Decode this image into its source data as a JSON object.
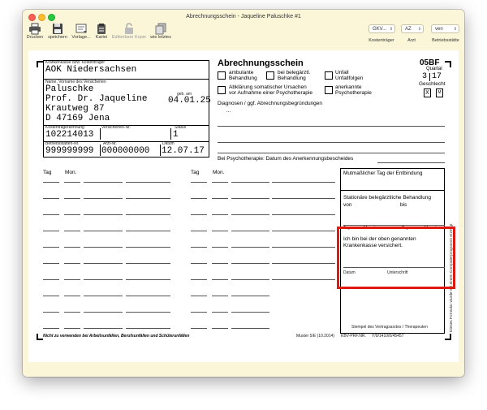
{
  "window": {
    "title": "Abrechnungsschein - Jaqueline Paluschke #1"
  },
  "toolbar": {
    "print_label": "Drucken",
    "save_label": "speichern",
    "template_label": "Vorlage...",
    "card_label": "Kartei",
    "edit_copy_label": "Editierbare Kopie",
    "as_last_label": "wie letztes",
    "payer_value": "GKV...",
    "payer_label": "Kostenträger",
    "doctor_value": "AZ",
    "doctor_label": "Arzt",
    "site_value": "ven",
    "site_label": "Betriebsstätte"
  },
  "form": {
    "insurer_label": "Krankenkasse bzw. Kostenträger",
    "insurer": "AOK Niedersachsen",
    "name_label": "Name, Vorname des Versicherten",
    "last_name": "Paluschke",
    "first_name": "Prof. Dr. Jaqueline",
    "birth_label": "geb. am",
    "birth_date": "04.01.25",
    "street": "Krautweg 87",
    "city": "D 47169 Jena",
    "payer_id_label": "Kostenträgerkennung",
    "insured_no_label": "Versicherten-Nr.",
    "status_label": "Status",
    "payer_id": "102214013",
    "status": "1",
    "site_no_label": "Betriebsstätten-Nr.",
    "doctor_no_label": "Arzt-Nr.",
    "date_label": "Datum",
    "site_no": "999999999",
    "doctor_no": "000000000",
    "date": "12.07.17",
    "title": "Abrechnungsschein",
    "form_code": "05BF",
    "quarter_label": "Quartal",
    "quarter": "3",
    "year": "17",
    "gender_label": "Geschlecht",
    "gender_x": "X",
    "gender_m": "M",
    "cb_ambulant": "ambulante\nBehandlung",
    "cb_belegarzt": "bei belegärztl.\nBehandlung",
    "cb_unfall": "Unfall\nUnfallfolgen",
    "cb_abklaerung": "Abklärung somatischer Ursachen\nvor Aufnahme einer Psychotherapie",
    "cb_anerkannt": "anerkannte\nPsychotherapie",
    "diagnoses_label": "Diagnosen / ggf. Abrechnungsbegründungen",
    "diagnoses_value": "...",
    "psycho_label": "Bei Psychotherapie: Datum des Anerkennungsbescheides",
    "col_tag": "Tag",
    "col_mon": "Mon.",
    "delivery_label": "Mutmaßlicher Tag der Entbindung",
    "inpatient_label": "Stationäre belegärztliche Behandlung",
    "from_label": "von",
    "to_label": "bis",
    "small_tag": "Tag",
    "small_monat": "Monat",
    "confirm_text": "Ich bin bei der oben genannten\nKrankenkasse versichert.",
    "datum_label": "Datum",
    "signature_label": "Unterschrift",
    "stamp_label": "Stempel des Vertragsarztes / Therapeuten",
    "side_text": "Dieses Formular wurde mit einem Computerprogramm erzeugt",
    "footer_left": "Nicht zu verwenden bei Arbeitsunfällen, Berufsunfällen und Schülerunfällen",
    "footer_muster": "Muster 5/E (10.2014)",
    "footer_kbv": "KBV-PRF.NR.",
    "footer_nr": "Y/9/1410/0/45457"
  }
}
